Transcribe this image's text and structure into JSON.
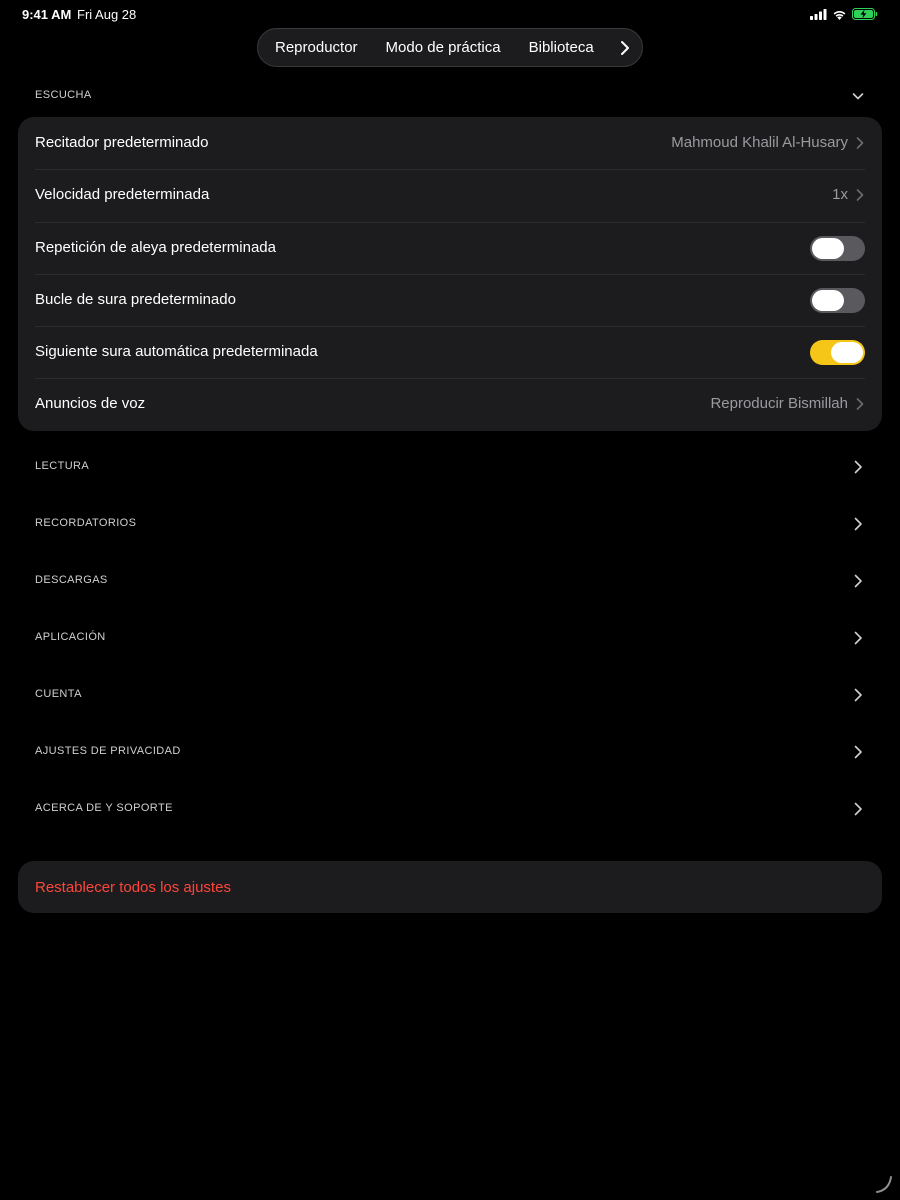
{
  "status_bar": {
    "time": "9:41 AM",
    "date": "Fri Aug 28"
  },
  "nav": {
    "tabs": [
      "Reproductor",
      "Modo de práctica",
      "Biblioteca"
    ],
    "more_icon": "chevron-right-icon"
  },
  "listening": {
    "header": "ESCUCHA",
    "rows": [
      {
        "label": "Recitador predeterminado",
        "value": "Mahmoud Khalil Al-Husary"
      },
      {
        "label": "Velocidad predeterminada",
        "value": "1x"
      },
      {
        "label": "Repetición de aleya predeterminada",
        "toggle_on": false
      },
      {
        "label": "Bucle de sura predeterminado",
        "toggle_on": false
      },
      {
        "label": "Siguiente sura automática predeterminada",
        "toggle_on": true
      },
      {
        "label": "Anuncios de voz",
        "value": "Reproducir Bismillah"
      }
    ]
  },
  "sections": [
    "LECTURA",
    "RECORDATORIOS",
    "DESCARGAS",
    "APLICACIÓN",
    "CUENTA",
    "AJUSTES DE PRIVACIDAD",
    "ACERCA DE Y SOPORTE"
  ],
  "reset": {
    "label": "Restablecer todos los ajustes"
  },
  "colors": {
    "background": "#000000",
    "card": "#1c1c1e",
    "accent_toggle": "#f5c518",
    "destructive": "#ff453a",
    "secondary_text": "#9a9a9f"
  }
}
